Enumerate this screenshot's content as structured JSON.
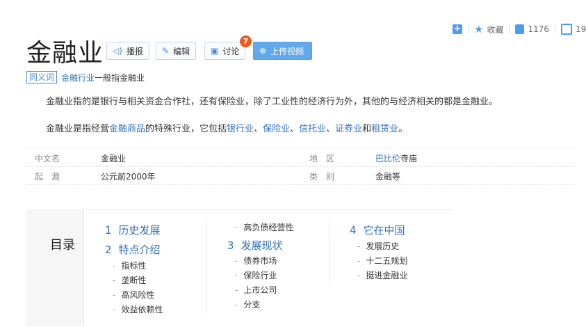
{
  "actions": {
    "plus_label": "+",
    "collect_label": "收藏",
    "like_count": "1176",
    "share_count": "19"
  },
  "title": "金融业",
  "toolbar": {
    "broadcast_label": "播报",
    "edit_label": "编辑",
    "discuss_label": "讨论",
    "discuss_badge": "7",
    "upload_label": "上传视频"
  },
  "synonym": {
    "tag": "同义词",
    "link": "金融行业",
    "suffix": "一般指金融业"
  },
  "paragraphs": {
    "p1": "金融业指的是银行与相关资金合作社，还有保险业，除了工业性的经济行为外，其他的与经济相关的都是金融业。",
    "p2_pre": "金融业是指经营",
    "p2_link1": "金融商品",
    "p2_mid": "的特殊行业，它包括",
    "p2_link2": "银行业",
    "p2_sep1": "、",
    "p2_link3": "保险业",
    "p2_sep2": "、",
    "p2_link4": "信托业",
    "p2_sep3": "、",
    "p2_link5": "证券业",
    "p2_and": "和",
    "p2_link6": "租赁业",
    "p2_end": "。"
  },
  "basic_info": {
    "row1": {
      "k1": "中文名",
      "v1": "金融业",
      "k2": "地　区",
      "v2_link": "巴比伦",
      "v2_rest": "寺庙"
    },
    "row2": {
      "k1": "起　源",
      "v1": "公元前2000年",
      "k2": "类　别",
      "v2": "金融等"
    }
  },
  "catalog": {
    "title": "目录",
    "col1": {
      "h1": {
        "num": "1",
        "label": "历史发展"
      },
      "h2": {
        "num": "2",
        "label": "特点介绍"
      },
      "subs": [
        "指标性",
        "垄断性",
        "高风险性",
        "效益依赖性"
      ]
    },
    "col2": {
      "top_sub": "高负债经营性",
      "h3": {
        "num": "3",
        "label": "发展现状"
      },
      "subs": [
        "债券市场",
        "保险行业",
        "上市公司",
        "分支"
      ]
    },
    "col3": {
      "h4": {
        "num": "4",
        "label": "它在中国"
      },
      "subs": [
        "发展历史",
        "十二五规划",
        "挺进金融业"
      ]
    }
  }
}
